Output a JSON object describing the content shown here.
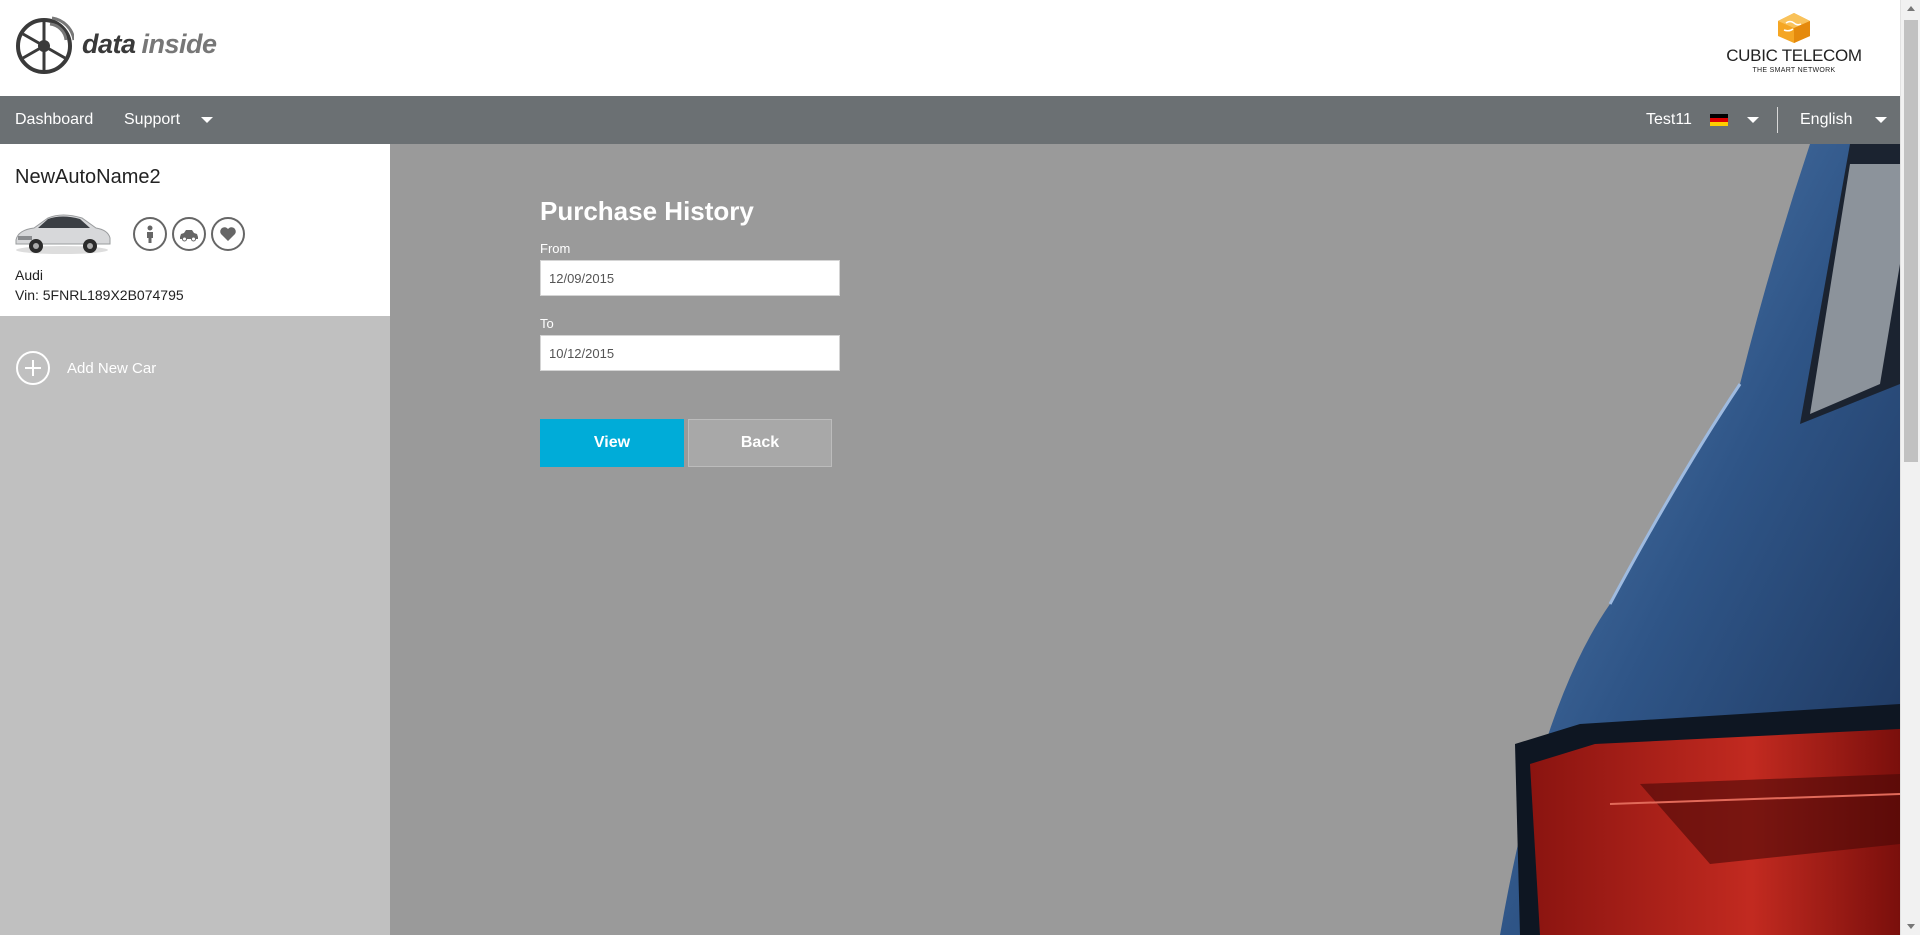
{
  "header": {
    "logo_word1": "data",
    "logo_word2": "inside",
    "brand_name": "CUBIC TELECOM",
    "brand_tagline": "THE SMART NETWORK"
  },
  "nav": {
    "dashboard": "Dashboard",
    "support": "Support",
    "user": "Test11",
    "language": "English"
  },
  "sidebar": {
    "car_name": "NewAutoName2",
    "make": "Audi",
    "vin": "Vin: 5FNRL189X2B074795",
    "add_car": "Add New Car"
  },
  "form": {
    "title": "Purchase History",
    "from_label": "From",
    "from_value": "12/09/2015",
    "to_label": "To",
    "to_value": "10/12/2015",
    "view_button": "View",
    "back_button": "Back"
  },
  "colors": {
    "nav_bg": "#6b7073",
    "sidebar_bg": "#c0c0c0",
    "main_bg": "#9a9a9a",
    "accent": "#00acd8",
    "secondary_button": "#a8a8a8"
  }
}
